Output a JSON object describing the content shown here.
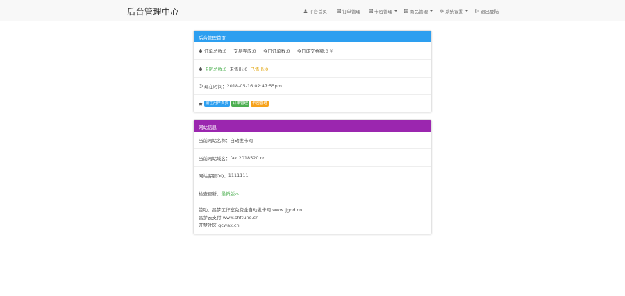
{
  "navbar": {
    "brand": "后台管理中心",
    "items": [
      {
        "label": "平台首页",
        "icon": "user-icon",
        "dropdown": false
      },
      {
        "label": "订单管理",
        "icon": "list-icon",
        "dropdown": false
      },
      {
        "label": "卡密管理",
        "icon": "list-icon",
        "dropdown": true
      },
      {
        "label": "商品管理",
        "icon": "list-icon",
        "dropdown": true
      },
      {
        "label": "系统设置",
        "icon": "gear-icon",
        "dropdown": true
      },
      {
        "label": "退出登陆",
        "icon": "sign-out-icon",
        "dropdown": false
      }
    ]
  },
  "admin_panel": {
    "title": "后台管理首页",
    "accent": "#2d9ff0",
    "stats": [
      {
        "label": "订单总数",
        "value": "0"
      },
      {
        "label": "交易完成",
        "value": "0"
      },
      {
        "label": "今日订单数",
        "value": "0"
      },
      {
        "label": "今日成交金额",
        "value": "0 ¥"
      }
    ],
    "card_stats": {
      "total_label": "卡密总数",
      "total_value": "0",
      "unsold_label": "未售出",
      "unsold_value": "0",
      "sold_label": "已售出",
      "sold_value": "0"
    },
    "time_label": "现在时间：",
    "time_value": "2018-05-16 02:47:55pm",
    "badges": [
      {
        "label": "前往用户首页",
        "color": "#2d9ff0"
      },
      {
        "label": "订单管理",
        "color": "#4caf50"
      },
      {
        "label": "卡密管理",
        "color": "#f7a21b"
      }
    ]
  },
  "site_panel": {
    "title": "网站信息",
    "accent": "#9b26af",
    "site_name_label": "当前网站名称：",
    "site_name_value": "自动发卡网",
    "domain_label": "当前网站域名：",
    "domain_value": "fak.2018520.cc",
    "qq_label": "网站客服QQ：",
    "qq_value": "1111111",
    "update_label": "检查更新：",
    "update_value": "最新版本",
    "footer_lines": [
      "赞助：昌梦工作室免费全自动发卡网 www.ijgdd.cn",
      "昌梦云支付 www.shftune.cn",
      "开梦社区 qcwax.cn"
    ]
  }
}
